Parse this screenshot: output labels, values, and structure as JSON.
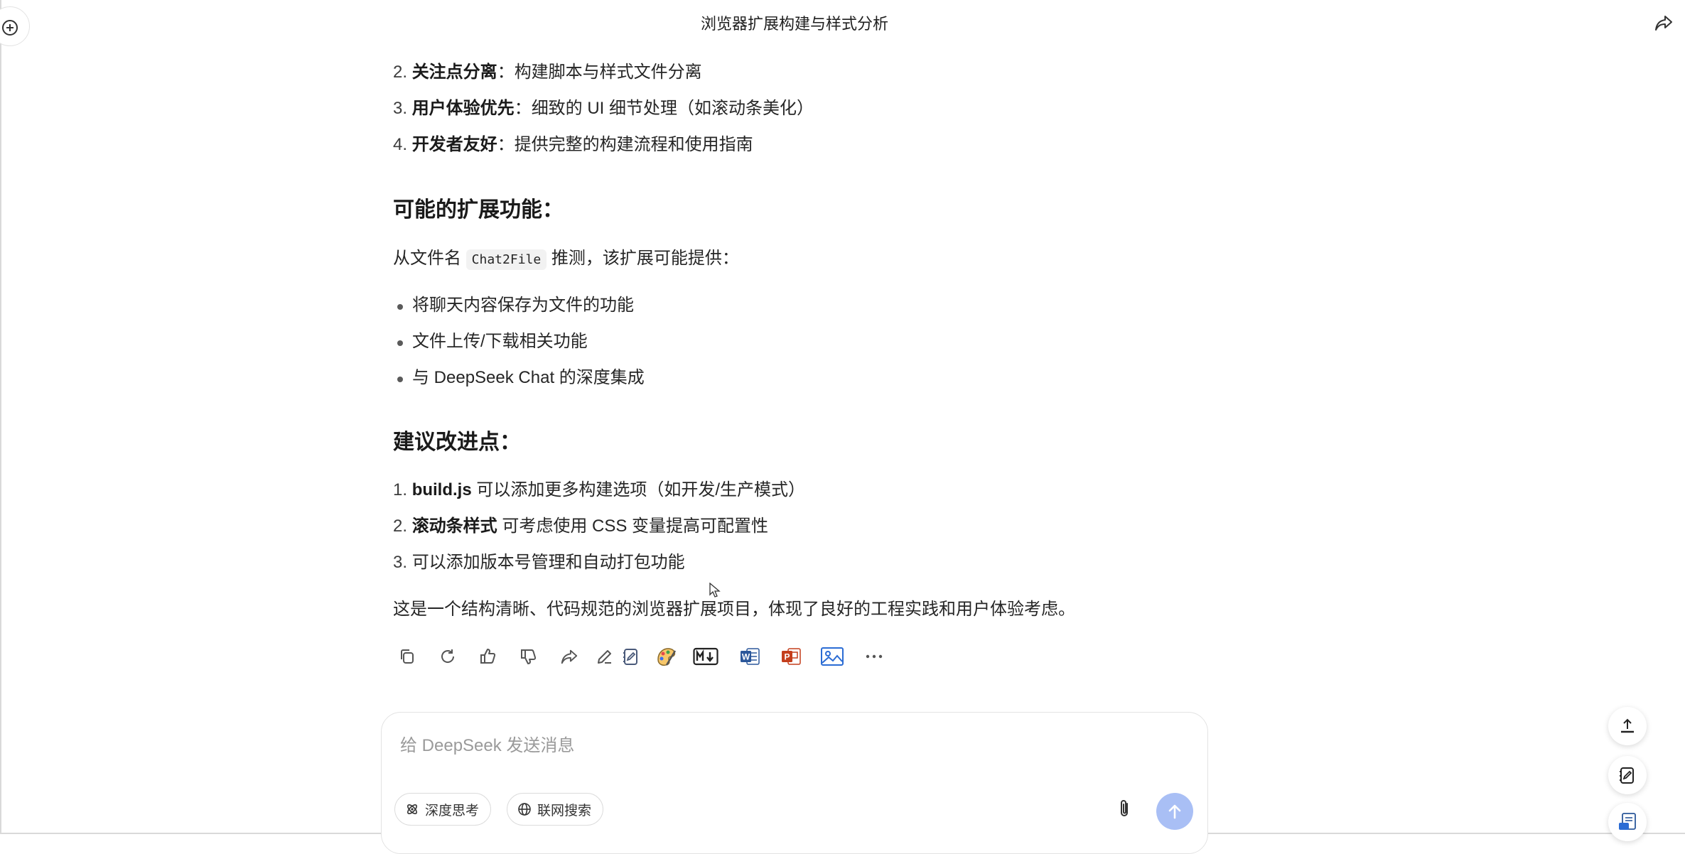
{
  "header": {
    "title": "浏览器扩展构建与样式分析"
  },
  "principles": [
    {
      "num": "2.",
      "bold": "关注点分离",
      "sep": "：",
      "text": "构建脚本与样式文件分离"
    },
    {
      "num": "3.",
      "bold": "用户体验优先",
      "sep": "：",
      "text": "细致的 UI 细节处理（如滚动条美化）"
    },
    {
      "num": "4.",
      "bold": "开发者友好",
      "sep": "：",
      "text": "提供完整的构建流程和使用指南"
    }
  ],
  "features": {
    "heading": "可能的扩展功能：",
    "intro_before": "从文件名 ",
    "intro_code": "Chat2File",
    "intro_after": " 推测，该扩展可能提供：",
    "items": [
      "将聊天内容保存为文件的功能",
      "文件上传/下载相关功能",
      "与 DeepSeek Chat 的深度集成"
    ]
  },
  "improvements": {
    "heading": "建议改进点：",
    "items": [
      {
        "num": "1.",
        "bold": "build.js",
        "text": " 可以添加更多构建选项（如开发/生产模式）"
      },
      {
        "num": "2.",
        "bold": "滚动条样式",
        "text": " 可考虑使用 CSS 变量提高可配置性"
      },
      {
        "num": "3.",
        "bold": "",
        "text": "可以添加版本号管理和自动打包功能"
      }
    ]
  },
  "summary": "这是一个结构清晰、代码规范的浏览器扩展项目，体现了良好的工程实践和用户体验考虑。",
  "toolbar_icons": [
    "copy-icon",
    "regenerate-icon",
    "thumbs-up-icon",
    "thumbs-down-icon",
    "share-icon",
    "edit-icon",
    "note-icon",
    "paint-icon",
    "markdown-icon",
    "word-icon",
    "powerpoint-icon",
    "image-icon",
    "more-icon"
  ],
  "input": {
    "placeholder": "给 DeepSeek 发送消息",
    "deep_think_label": "深度思考",
    "web_search_label": "联网搜索"
  },
  "colors": {
    "accent": "#4d6bfe",
    "send_disabled": "#a9bff5",
    "word": "#2b579a",
    "powerpoint": "#c43e1c"
  }
}
